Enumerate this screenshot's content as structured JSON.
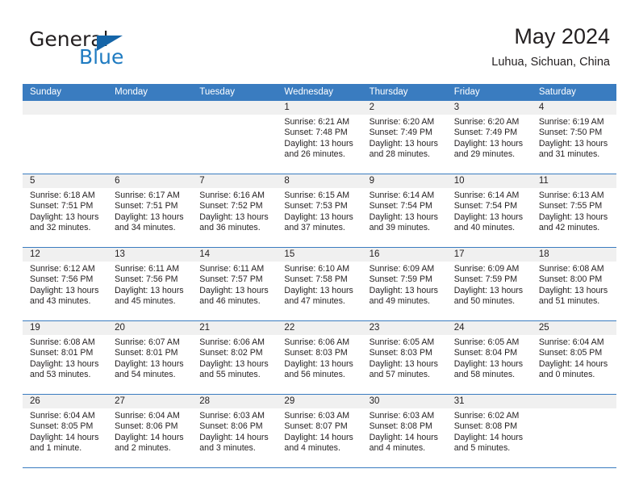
{
  "brand": {
    "name_part1": "General",
    "name_part2": "Blue",
    "triangle_icon": "triangle-icon",
    "color_dark": "#231f20",
    "color_blue": "#1f7bc1"
  },
  "header": {
    "title": "May 2024",
    "location": "Luhua, Sichuan, China"
  },
  "theme": {
    "header_bar": "#3a7cc0",
    "daynum_bg": "#f0f0f0",
    "text": "#231f20"
  },
  "weekdays": [
    "Sunday",
    "Monday",
    "Tuesday",
    "Wednesday",
    "Thursday",
    "Friday",
    "Saturday"
  ],
  "labels": {
    "sunrise": "Sunrise:",
    "sunset": "Sunset:",
    "daylight": "Daylight:"
  },
  "weeks": [
    [
      {
        "day": "",
        "sunrise": "",
        "sunset": "",
        "daylight": ""
      },
      {
        "day": "",
        "sunrise": "",
        "sunset": "",
        "daylight": ""
      },
      {
        "day": "",
        "sunrise": "",
        "sunset": "",
        "daylight": ""
      },
      {
        "day": "1",
        "sunrise": "Sunrise: 6:21 AM",
        "sunset": "Sunset: 7:48 PM",
        "daylight": "Daylight: 13 hours and 26 minutes."
      },
      {
        "day": "2",
        "sunrise": "Sunrise: 6:20 AM",
        "sunset": "Sunset: 7:49 PM",
        "daylight": "Daylight: 13 hours and 28 minutes."
      },
      {
        "day": "3",
        "sunrise": "Sunrise: 6:20 AM",
        "sunset": "Sunset: 7:49 PM",
        "daylight": "Daylight: 13 hours and 29 minutes."
      },
      {
        "day": "4",
        "sunrise": "Sunrise: 6:19 AM",
        "sunset": "Sunset: 7:50 PM",
        "daylight": "Daylight: 13 hours and 31 minutes."
      }
    ],
    [
      {
        "day": "5",
        "sunrise": "Sunrise: 6:18 AM",
        "sunset": "Sunset: 7:51 PM",
        "daylight": "Daylight: 13 hours and 32 minutes."
      },
      {
        "day": "6",
        "sunrise": "Sunrise: 6:17 AM",
        "sunset": "Sunset: 7:51 PM",
        "daylight": "Daylight: 13 hours and 34 minutes."
      },
      {
        "day": "7",
        "sunrise": "Sunrise: 6:16 AM",
        "sunset": "Sunset: 7:52 PM",
        "daylight": "Daylight: 13 hours and 36 minutes."
      },
      {
        "day": "8",
        "sunrise": "Sunrise: 6:15 AM",
        "sunset": "Sunset: 7:53 PM",
        "daylight": "Daylight: 13 hours and 37 minutes."
      },
      {
        "day": "9",
        "sunrise": "Sunrise: 6:14 AM",
        "sunset": "Sunset: 7:54 PM",
        "daylight": "Daylight: 13 hours and 39 minutes."
      },
      {
        "day": "10",
        "sunrise": "Sunrise: 6:14 AM",
        "sunset": "Sunset: 7:54 PM",
        "daylight": "Daylight: 13 hours and 40 minutes."
      },
      {
        "day": "11",
        "sunrise": "Sunrise: 6:13 AM",
        "sunset": "Sunset: 7:55 PM",
        "daylight": "Daylight: 13 hours and 42 minutes."
      }
    ],
    [
      {
        "day": "12",
        "sunrise": "Sunrise: 6:12 AM",
        "sunset": "Sunset: 7:56 PM",
        "daylight": "Daylight: 13 hours and 43 minutes."
      },
      {
        "day": "13",
        "sunrise": "Sunrise: 6:11 AM",
        "sunset": "Sunset: 7:56 PM",
        "daylight": "Daylight: 13 hours and 45 minutes."
      },
      {
        "day": "14",
        "sunrise": "Sunrise: 6:11 AM",
        "sunset": "Sunset: 7:57 PM",
        "daylight": "Daylight: 13 hours and 46 minutes."
      },
      {
        "day": "15",
        "sunrise": "Sunrise: 6:10 AM",
        "sunset": "Sunset: 7:58 PM",
        "daylight": "Daylight: 13 hours and 47 minutes."
      },
      {
        "day": "16",
        "sunrise": "Sunrise: 6:09 AM",
        "sunset": "Sunset: 7:59 PM",
        "daylight": "Daylight: 13 hours and 49 minutes."
      },
      {
        "day": "17",
        "sunrise": "Sunrise: 6:09 AM",
        "sunset": "Sunset: 7:59 PM",
        "daylight": "Daylight: 13 hours and 50 minutes."
      },
      {
        "day": "18",
        "sunrise": "Sunrise: 6:08 AM",
        "sunset": "Sunset: 8:00 PM",
        "daylight": "Daylight: 13 hours and 51 minutes."
      }
    ],
    [
      {
        "day": "19",
        "sunrise": "Sunrise: 6:08 AM",
        "sunset": "Sunset: 8:01 PM",
        "daylight": "Daylight: 13 hours and 53 minutes."
      },
      {
        "day": "20",
        "sunrise": "Sunrise: 6:07 AM",
        "sunset": "Sunset: 8:01 PM",
        "daylight": "Daylight: 13 hours and 54 minutes."
      },
      {
        "day": "21",
        "sunrise": "Sunrise: 6:06 AM",
        "sunset": "Sunset: 8:02 PM",
        "daylight": "Daylight: 13 hours and 55 minutes."
      },
      {
        "day": "22",
        "sunrise": "Sunrise: 6:06 AM",
        "sunset": "Sunset: 8:03 PM",
        "daylight": "Daylight: 13 hours and 56 minutes."
      },
      {
        "day": "23",
        "sunrise": "Sunrise: 6:05 AM",
        "sunset": "Sunset: 8:03 PM",
        "daylight": "Daylight: 13 hours and 57 minutes."
      },
      {
        "day": "24",
        "sunrise": "Sunrise: 6:05 AM",
        "sunset": "Sunset: 8:04 PM",
        "daylight": "Daylight: 13 hours and 58 minutes."
      },
      {
        "day": "25",
        "sunrise": "Sunrise: 6:04 AM",
        "sunset": "Sunset: 8:05 PM",
        "daylight": "Daylight: 14 hours and 0 minutes."
      }
    ],
    [
      {
        "day": "26",
        "sunrise": "Sunrise: 6:04 AM",
        "sunset": "Sunset: 8:05 PM",
        "daylight": "Daylight: 14 hours and 1 minute."
      },
      {
        "day": "27",
        "sunrise": "Sunrise: 6:04 AM",
        "sunset": "Sunset: 8:06 PM",
        "daylight": "Daylight: 14 hours and 2 minutes."
      },
      {
        "day": "28",
        "sunrise": "Sunrise: 6:03 AM",
        "sunset": "Sunset: 8:06 PM",
        "daylight": "Daylight: 14 hours and 3 minutes."
      },
      {
        "day": "29",
        "sunrise": "Sunrise: 6:03 AM",
        "sunset": "Sunset: 8:07 PM",
        "daylight": "Daylight: 14 hours and 4 minutes."
      },
      {
        "day": "30",
        "sunrise": "Sunrise: 6:03 AM",
        "sunset": "Sunset: 8:08 PM",
        "daylight": "Daylight: 14 hours and 4 minutes."
      },
      {
        "day": "31",
        "sunrise": "Sunrise: 6:02 AM",
        "sunset": "Sunset: 8:08 PM",
        "daylight": "Daylight: 14 hours and 5 minutes."
      },
      {
        "day": "",
        "sunrise": "",
        "sunset": "",
        "daylight": ""
      }
    ]
  ]
}
